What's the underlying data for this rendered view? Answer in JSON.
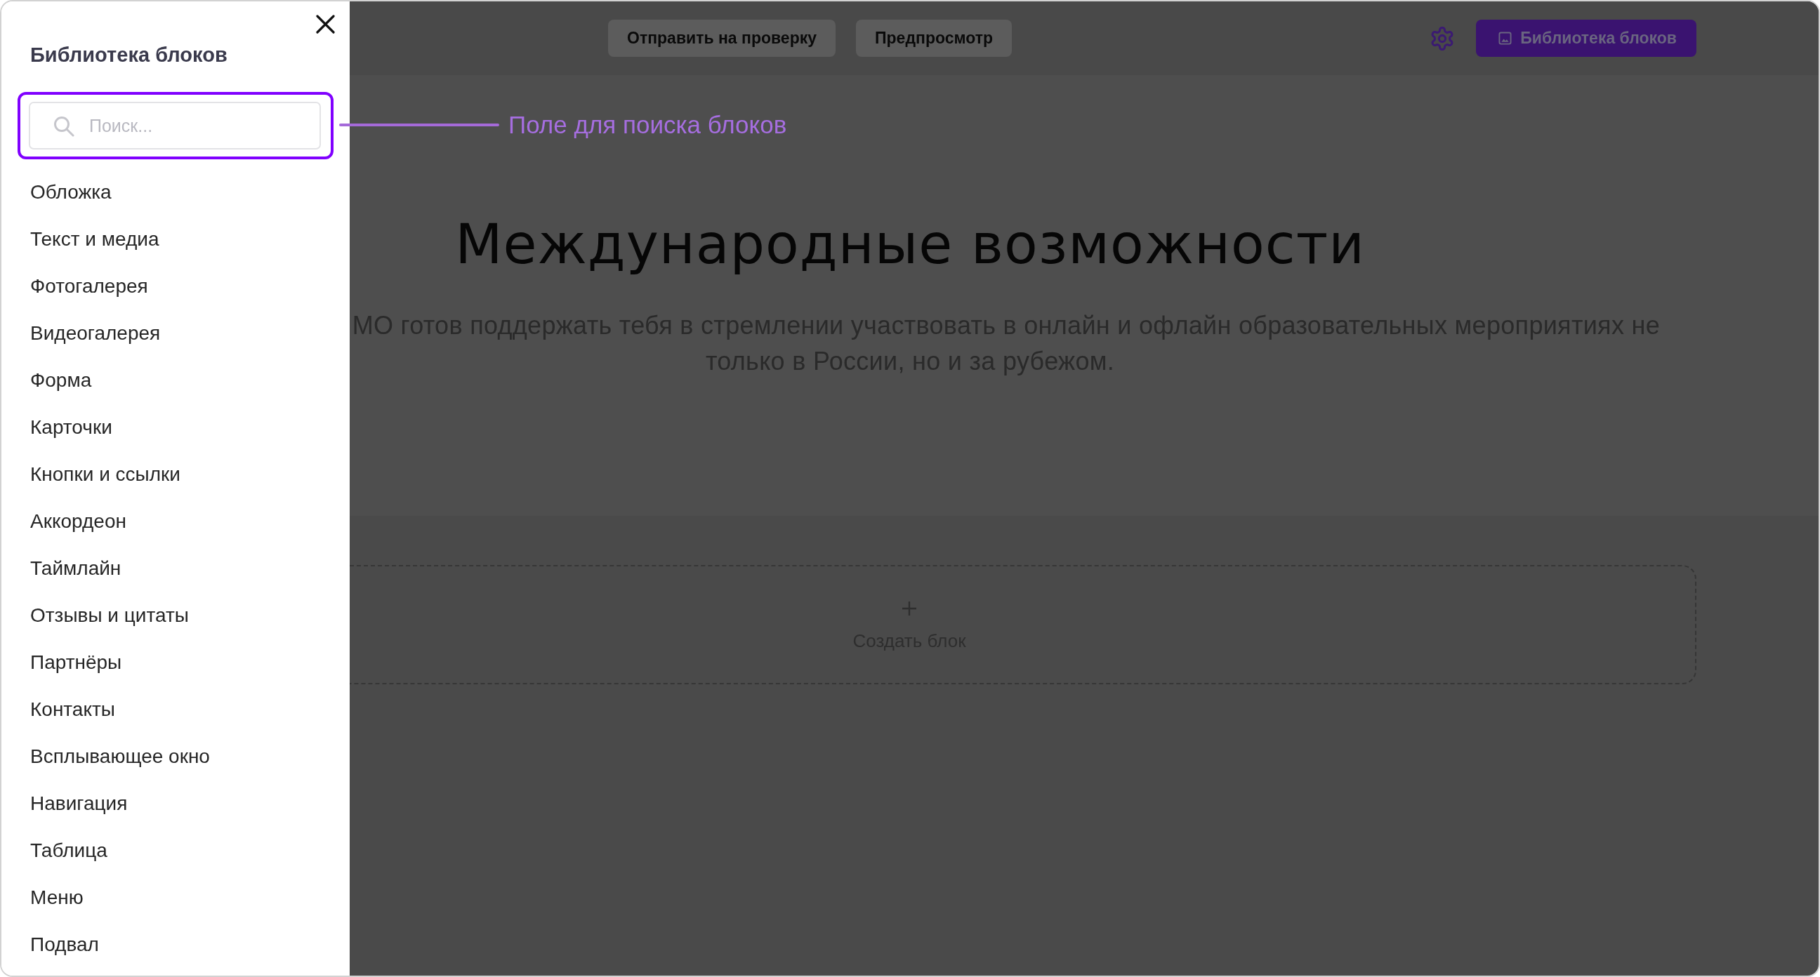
{
  "sidebar": {
    "title": "Библиотека блоков",
    "search": {
      "placeholder": "Поиск..."
    },
    "items": [
      "Обложка",
      "Текст и медиа",
      "Фотогалерея",
      "Видеогалерея",
      "Форма",
      "Карточки",
      "Кнопки и ссылки",
      "Аккордеон",
      "Таймлайн",
      "Отзывы и цитаты",
      "Партнёры",
      "Контакты",
      "Всплывающее окно",
      "Навигация",
      "Таблица",
      "Меню",
      "Подвал"
    ]
  },
  "annotation": {
    "label": "Поле для поиска блоков"
  },
  "toolbar": {
    "buttons": [
      {
        "kind": "secondary",
        "label": "Отправить на проверку"
      },
      {
        "kind": "secondary",
        "label": "Предпросмотр"
      },
      {
        "kind": "settings"
      },
      {
        "kind": "primary",
        "label": "Библиотека блоков"
      }
    ]
  },
  "page": {
    "heading": "Международные возможности",
    "paragraph_lines": [
      "МО готов поддержать тебя в стремлении участвовать в онлайн и офлайн образовательных мероприятиях не",
      "только в России, но и за рубежом."
    ],
    "create_block": {
      "label": "Создать блок"
    }
  }
}
